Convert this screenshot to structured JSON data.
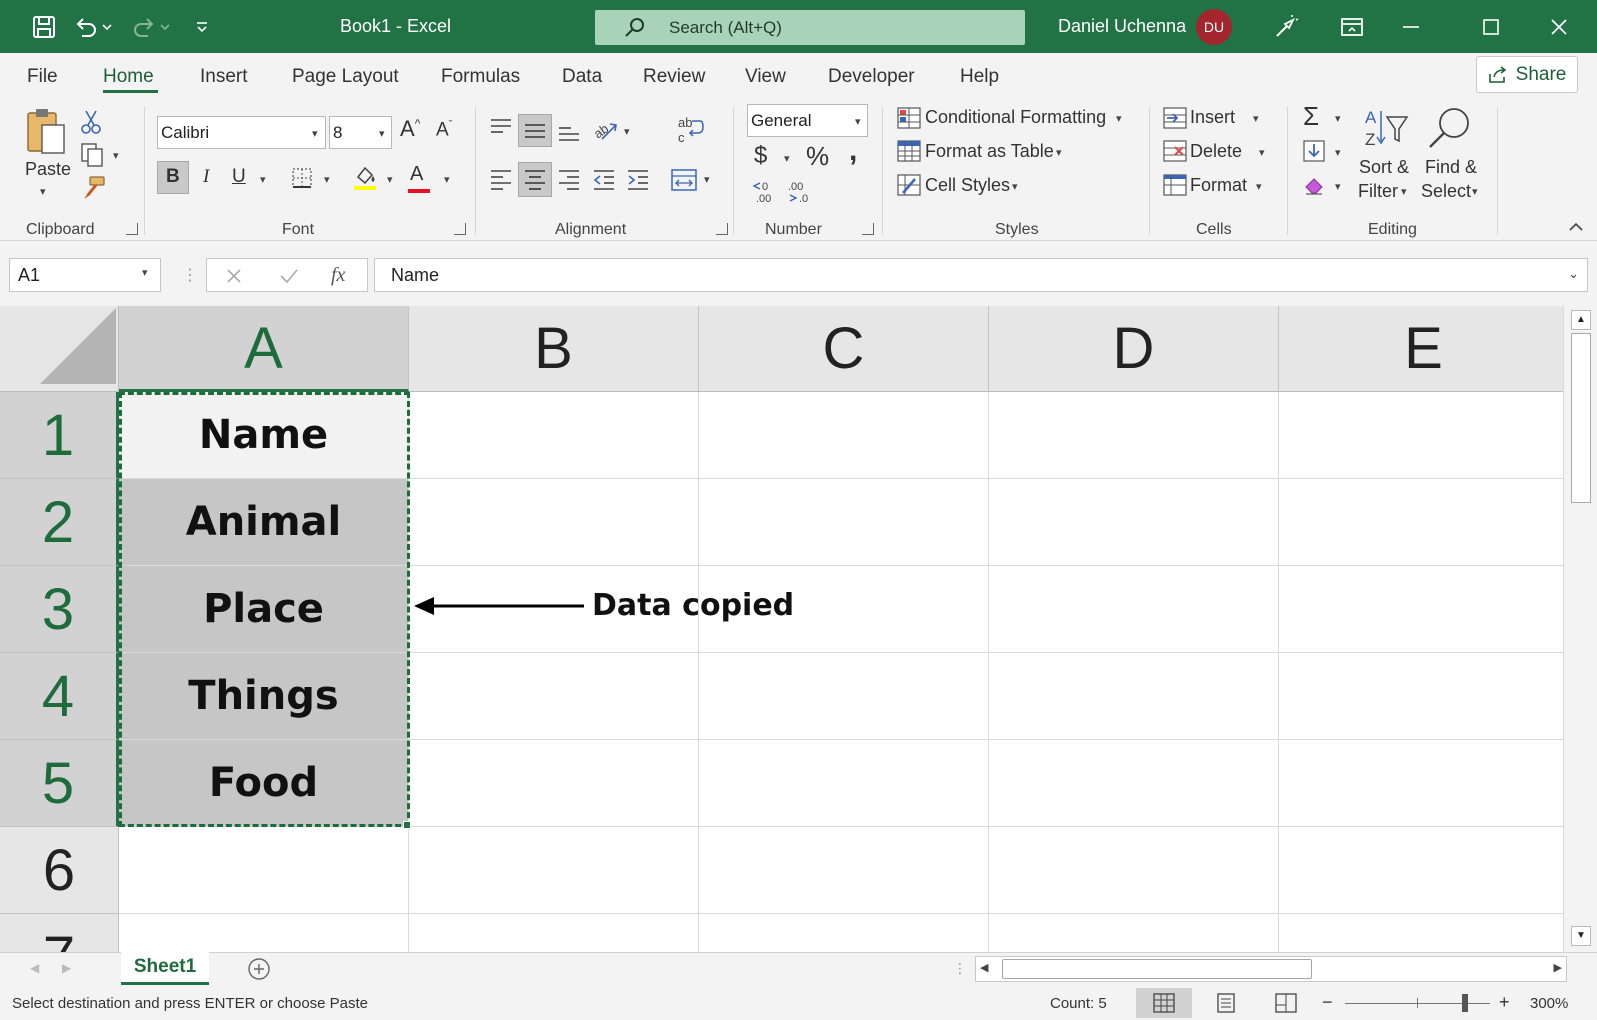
{
  "window": {
    "title": "Book1  -  Excel",
    "search_placeholder": "Search (Alt+Q)",
    "user_name": "Daniel Uchenna",
    "user_initials": "DU"
  },
  "ribbon_tabs": [
    "File",
    "Home",
    "Insert",
    "Page Layout",
    "Formulas",
    "Data",
    "Review",
    "View",
    "Developer",
    "Help"
  ],
  "active_tab": "Home",
  "share_label": "Share",
  "clipboard": {
    "paste_label": "Paste",
    "group_label": "Clipboard"
  },
  "font": {
    "name": "Calibri",
    "size": "8",
    "bold": "B",
    "italic": "I",
    "underline": "U",
    "font_color_glyph": "A",
    "group_label": "Font"
  },
  "alignment": {
    "group_label": "Alignment"
  },
  "number": {
    "format": "General",
    "currency": "$",
    "percent": "%",
    "comma": ",",
    "group_label": "Number"
  },
  "styles": {
    "conditional": "Conditional Formatting",
    "format_table": "Format as Table",
    "cell_styles": "Cell Styles",
    "group_label": "Styles"
  },
  "cells": {
    "insert": "Insert",
    "delete": "Delete",
    "format": "Format",
    "group_label": "Cells"
  },
  "editing": {
    "sort_l1": "Sort &",
    "sort_l2": "Filter",
    "find_l1": "Find &",
    "find_l2": "Select",
    "group_label": "Editing"
  },
  "formula_bar": {
    "name_box": "A1",
    "fx": "fx",
    "content": "Name"
  },
  "grid": {
    "columns": [
      "A",
      "B",
      "C",
      "D",
      "E"
    ],
    "rows": [
      "1",
      "2",
      "3",
      "4",
      "5",
      "6",
      "7"
    ],
    "column_a_values": [
      "Name",
      "Animal",
      "Place",
      "Things",
      "Food"
    ],
    "annotation": "Data copied"
  },
  "sheet_tab": "Sheet1",
  "status": {
    "message": "Select destination and press ENTER or choose Paste",
    "count": "Count: 5",
    "zoom": "300%"
  },
  "colors": {
    "excel_green": "#217346",
    "avatar": "#a4262c",
    "selection_fill": "#c6c6c6",
    "font_color_underline": "#e81123"
  }
}
